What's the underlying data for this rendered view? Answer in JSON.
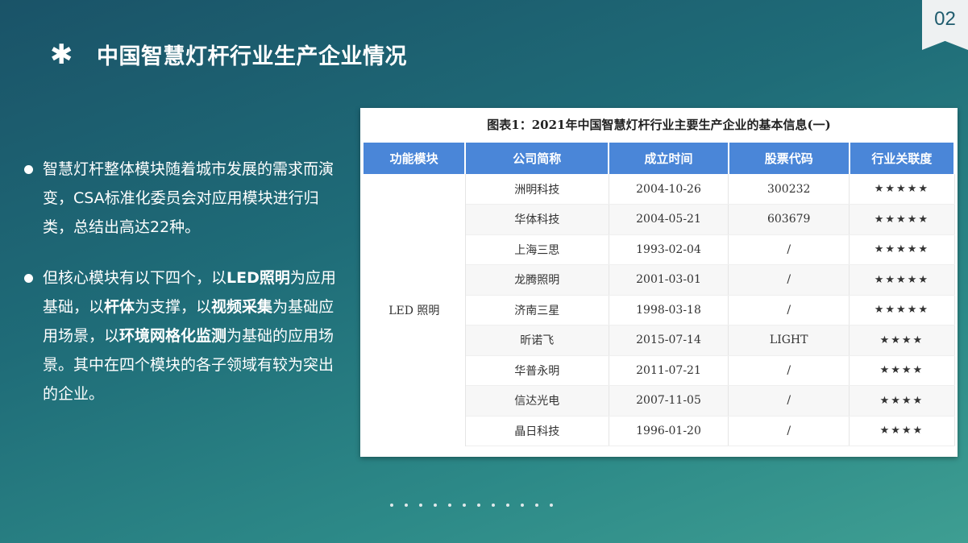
{
  "page_number": "02",
  "title": {
    "icon": "asterisk-icon",
    "text": "中国智慧灯杆行业生产企业情况"
  },
  "bullets": [
    {
      "segments": [
        {
          "text": "智慧灯杆整体模块随着城市发展的需求而演变，CSA标准化委员会对应用模块进行归类，总结出高达22种。",
          "bold": false
        }
      ]
    },
    {
      "segments": [
        {
          "text": "但核心模块有以下四个，以",
          "bold": false
        },
        {
          "text": "LED照明",
          "bold": true
        },
        {
          "text": "为应用基础，以",
          "bold": false
        },
        {
          "text": "杆体",
          "bold": true
        },
        {
          "text": "为支撑，以",
          "bold": false
        },
        {
          "text": "视频采集",
          "bold": true
        },
        {
          "text": "为基础应用场景，以",
          "bold": false
        },
        {
          "text": "环境网格化监测",
          "bold": true
        },
        {
          "text": "为基础的应用场景。其中在四个模块的各子领域有较为突出的企业。",
          "bold": false
        }
      ]
    }
  ],
  "table": {
    "title": "图表1：2021年中国智慧灯杆行业主要生产企业的基本信息(一)",
    "headers": [
      "功能模块",
      "公司简称",
      "成立时间",
      "股票代码",
      "行业关联度"
    ],
    "module": "LED 照明",
    "rows": [
      [
        "洲明科技",
        "2004-10-26",
        "300232",
        "★★★★★"
      ],
      [
        "华体科技",
        "2004-05-21",
        "603679",
        "★★★★★"
      ],
      [
        "上海三思",
        "1993-02-04",
        "/",
        "★★★★★"
      ],
      [
        "龙腾照明",
        "2001-03-01",
        "/",
        "★★★★★"
      ],
      [
        "济南三星",
        "1998-03-18",
        "/",
        "★★★★★"
      ],
      [
        "昕诺飞",
        "2015-07-14",
        "LIGHT",
        "★★★★"
      ],
      [
        "华普永明",
        "2011-07-21",
        "/",
        "★★★★"
      ],
      [
        "信达光电",
        "2007-11-05",
        "/",
        "★★★★"
      ],
      [
        "晶日科技",
        "1996-01-20",
        "/",
        "★★★★"
      ]
    ]
  },
  "pagination_dot_count": 12,
  "colors": {
    "header_blue": "#4a86d8",
    "background_dark": "#1a5368",
    "background_light": "#3e9e92"
  }
}
